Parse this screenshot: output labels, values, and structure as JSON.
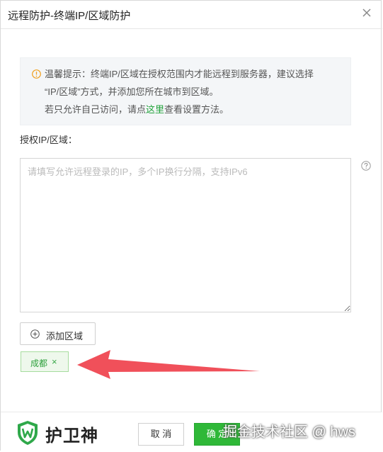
{
  "dialog": {
    "title": "远程防护-终端IP/区域防护"
  },
  "tip": {
    "line1": "温馨提示：终端IP/区域在授权范围内才能远程到服务器，建议选择",
    "line2": "“IP/区域”方式，并添加您所在城市到区域。",
    "line3_pre": "若只允许自己访问，请点",
    "line3_link": "这里",
    "line3_post": "查看设置方法。"
  },
  "field": {
    "label": "授权IP/区域：",
    "placeholder": "请填写允许远程登录的IP，多个IP换行分隔，支持IPv6",
    "value": ""
  },
  "add_region_button": "添加区域",
  "tags": [
    {
      "label": "成都",
      "remove": "×"
    }
  ],
  "footer": {
    "brand": "护卫神",
    "cancel_label": "取 消",
    "ok_label": "确 定"
  },
  "watermark": "掘金技术社区 @ hws",
  "colors": {
    "accent": "#2fb838",
    "arrow": "#f0505a",
    "tip_bg": "#f4f6f8",
    "warning": "#f0a020"
  }
}
